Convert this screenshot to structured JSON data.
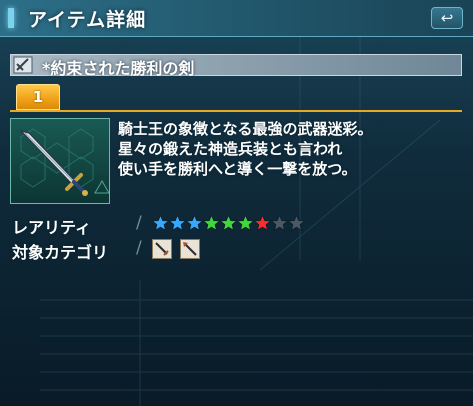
{
  "window": {
    "title": "アイテム詳細",
    "close_glyph": "↩"
  },
  "item": {
    "name": "*約束された勝利の剣",
    "tab_label": "1",
    "description": [
      "騎士王の象徴となる最強の武器迷彩。",
      "星々の鍛えた神造兵装とも言われ",
      "使い手を勝利へと導く一撃を放つ。"
    ]
  },
  "rarity": {
    "label": "レアリティ",
    "separator": "/",
    "stars": [
      {
        "color": "#35a9ff"
      },
      {
        "color": "#35a9ff"
      },
      {
        "color": "#35a9ff"
      },
      {
        "color": "#3fd83c"
      },
      {
        "color": "#3fd83c"
      },
      {
        "color": "#3fd83c"
      },
      {
        "color": "#ff2a2a"
      },
      {
        "color": "#4b5a62"
      },
      {
        "color": "#4b5a62"
      }
    ]
  },
  "category": {
    "label": "対象カテゴリ",
    "separator": "/",
    "icons": [
      "sword-category-icon",
      "partizan-category-icon"
    ]
  }
}
